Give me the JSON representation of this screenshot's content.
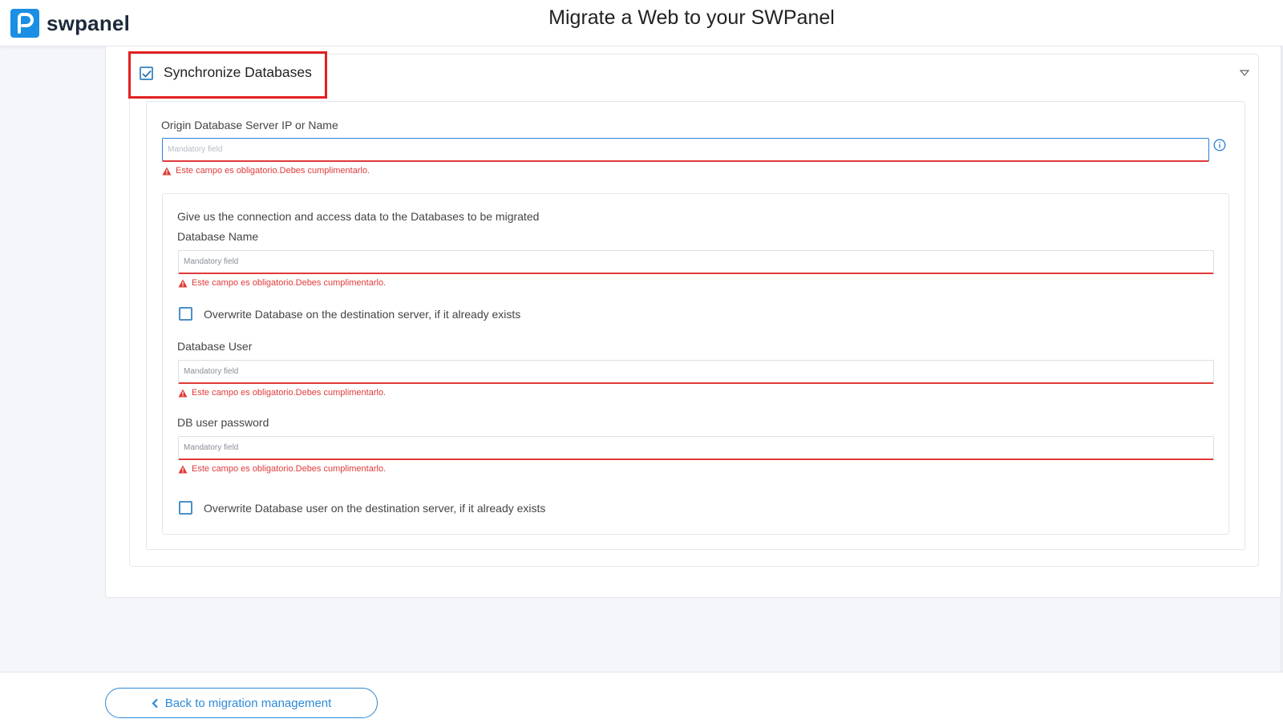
{
  "app": {
    "brand": "swpanel",
    "page_title": "Migrate a Web to your SWPanel"
  },
  "section": {
    "title": "Synchronize Databases",
    "checked": true
  },
  "origin": {
    "label": "Origin Database Server IP or Name",
    "placeholder": "Mandatory field",
    "error": "Este campo es obligatorio.Debes cumplimentarlo."
  },
  "connection": {
    "intro": "Give us the connection and access data to the Databases to be migrated",
    "db_name": {
      "label": "Database Name",
      "placeholder": "Mandatory field",
      "error": "Este campo es obligatorio.Debes cumplimentarlo."
    },
    "overwrite_db": {
      "label": "Overwrite Database on the destination server, if it already exists",
      "checked": false
    },
    "db_user": {
      "label": "Database User",
      "placeholder": "Mandatory field",
      "error": "Este campo es obligatorio.Debes cumplimentarlo."
    },
    "db_password": {
      "label": "DB user password",
      "placeholder": "Mandatory field",
      "error": "Este campo es obligatorio.Debes cumplimentarlo."
    },
    "overwrite_user": {
      "label": "Overwrite Database user on the destination server, if it already exists",
      "checked": false
    }
  },
  "footer": {
    "back_label": "Back to migration management"
  },
  "icons": {
    "logo": "swpanel-logo-icon",
    "section_check": "checkbox-checked-icon",
    "collapse": "chevron-down-icon",
    "info": "info-icon",
    "error": "warning-triangle-icon",
    "back": "chevron-left-icon"
  },
  "colors": {
    "brand": "#1a8fe3",
    "error": "#e03a3a",
    "highlight": "#e32020",
    "link": "#2b8ad8"
  }
}
